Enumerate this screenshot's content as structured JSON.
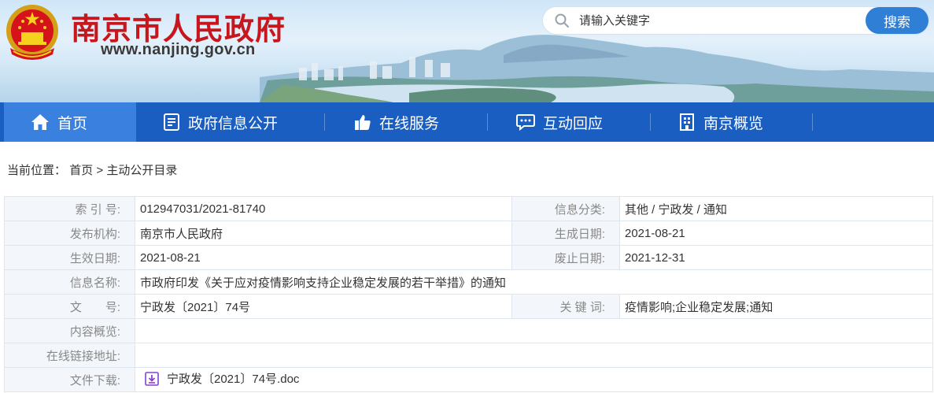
{
  "header": {
    "site_title": "南京市人民政府",
    "site_url": "www.nanjing.gov.cn"
  },
  "search": {
    "placeholder": "请输入关键字",
    "button_label": "搜索"
  },
  "nav": {
    "items": [
      {
        "label": "首页",
        "icon": "home-icon"
      },
      {
        "label": "政府信息公开",
        "icon": "document-icon"
      },
      {
        "label": "在线服务",
        "icon": "thumbs-up-icon"
      },
      {
        "label": "互动回应",
        "icon": "chat-icon"
      },
      {
        "label": "南京概览",
        "icon": "building-icon"
      }
    ]
  },
  "breadcrumb": {
    "prefix": "当前位置：",
    "home": "首页",
    "separator": ">",
    "current": "主动公开目录"
  },
  "info": {
    "index_label": "索 引 号:",
    "index_value": "012947031/2021-81740",
    "category_label": "信息分类:",
    "category_value": "其他 / 宁政发 / 通知",
    "publisher_label": "发布机构:",
    "publisher_value": "南京市人民政府",
    "created_label": "生成日期:",
    "created_value": "2021-08-21",
    "effective_label": "生效日期:",
    "effective_value": "2021-08-21",
    "expire_label": "废止日期:",
    "expire_value": "2021-12-31",
    "name_label": "信息名称:",
    "name_value": "市政府印发《关于应对疫情影响支持企业稳定发展的若干举措》的通知",
    "docno_label": "文　　号:",
    "docno_value": "宁政发〔2021〕74号",
    "keywords_label": "关 键 词:",
    "keywords_value": "疫情影响;企业稳定发展;通知",
    "summary_label": "内容概览:",
    "summary_value": "",
    "link_label": "在线链接地址:",
    "link_value": "",
    "download_label": "文件下载:",
    "download_value": "宁政发〔2021〕74号.doc"
  },
  "colors": {
    "title_red": "#c8161d",
    "nav_blue": "#1b5ec2",
    "nav_active": "#3a80de",
    "search_button": "#2f7fd6",
    "download_icon": "#8a3fd1"
  }
}
